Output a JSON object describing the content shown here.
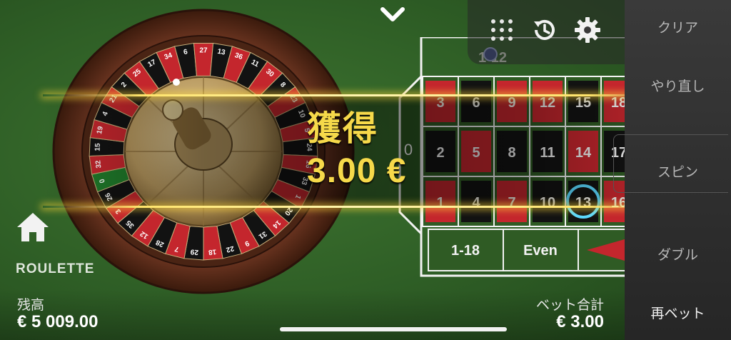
{
  "game": {
    "name": "ROULETTE"
  },
  "win": {
    "label": "獲得",
    "amount": "3.00 €"
  },
  "sidebar": {
    "items": [
      {
        "label": "クリア"
      },
      {
        "label": "やり直し"
      },
      {
        "label": "スピン"
      },
      {
        "label": "ダブル"
      },
      {
        "label": "再ベット"
      }
    ]
  },
  "footer": {
    "balance_label": "残高",
    "balance_value": "€ 5 009.00",
    "total_bet_label": "ベット合計",
    "total_bet_value": "€ 3.00"
  },
  "wheel": {
    "numbers": [
      "0",
      "32",
      "15",
      "19",
      "4",
      "21",
      "2",
      "25",
      "17",
      "34",
      "6",
      "27",
      "13",
      "36",
      "11",
      "30",
      "8",
      "23",
      "10",
      "5",
      "24",
      "16",
      "33",
      "1",
      "20",
      "14",
      "31",
      "9",
      "22",
      "18",
      "29",
      "7",
      "28",
      "12",
      "35",
      "3",
      "26"
    ],
    "reds": [
      "32",
      "19",
      "21",
      "25",
      "34",
      "27",
      "36",
      "30",
      "23",
      "5",
      "16",
      "1",
      "14",
      "9",
      "18",
      "7",
      "12",
      "3"
    ]
  },
  "table": {
    "zero": "0",
    "top_label": "1-12",
    "rows": [
      [
        {
          "n": "3",
          "c": "red"
        },
        {
          "n": "6",
          "c": "black"
        },
        {
          "n": "9",
          "c": "red"
        },
        {
          "n": "12",
          "c": "red"
        },
        {
          "n": "15",
          "c": "black"
        },
        {
          "n": "18",
          "c": "red"
        }
      ],
      [
        {
          "n": "2",
          "c": "black"
        },
        {
          "n": "5",
          "c": "red"
        },
        {
          "n": "8",
          "c": "black"
        },
        {
          "n": "11",
          "c": "black"
        },
        {
          "n": "14",
          "c": "red"
        },
        {
          "n": "17",
          "c": "black"
        }
      ],
      [
        {
          "n": "1",
          "c": "red"
        },
        {
          "n": "4",
          "c": "black"
        },
        {
          "n": "7",
          "c": "red"
        },
        {
          "n": "10",
          "c": "black"
        },
        {
          "n": "13",
          "c": "black"
        },
        {
          "n": "16",
          "c": "red"
        }
      ]
    ],
    "outside": [
      "1-18",
      "Even"
    ],
    "highlighted": "13"
  },
  "colors": {
    "red": "#c4262d",
    "black": "#121212",
    "gold": "#f6d94a",
    "felt": "#2f5b24"
  }
}
